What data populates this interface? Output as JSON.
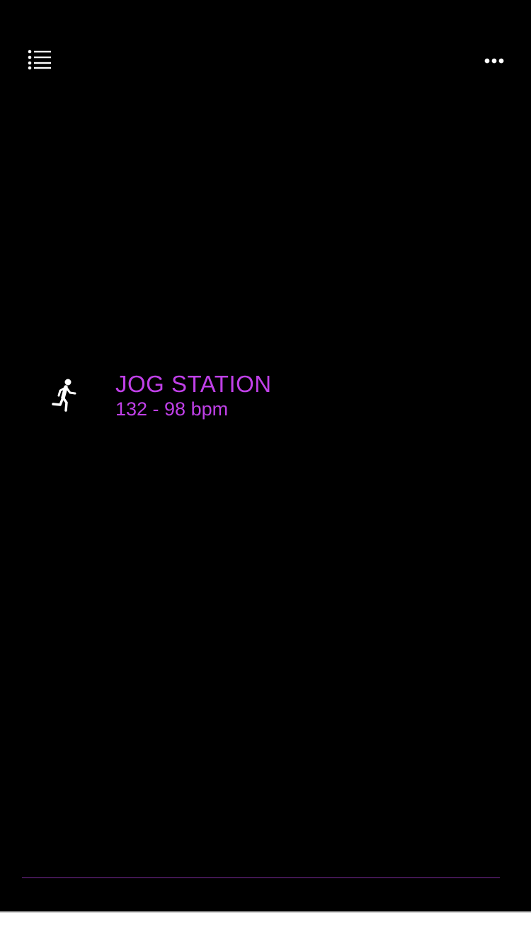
{
  "colors": {
    "background": "#000000",
    "accent": "#c040e8",
    "icon": "#ffffff",
    "divider": "#7a2a9a"
  },
  "header": {
    "menu_icon": "list-icon",
    "more_icon": "ellipsis-icon"
  },
  "station": {
    "icon": "running-person-icon",
    "name": "JOG STATION",
    "bpm": "132 - 98 bpm"
  }
}
